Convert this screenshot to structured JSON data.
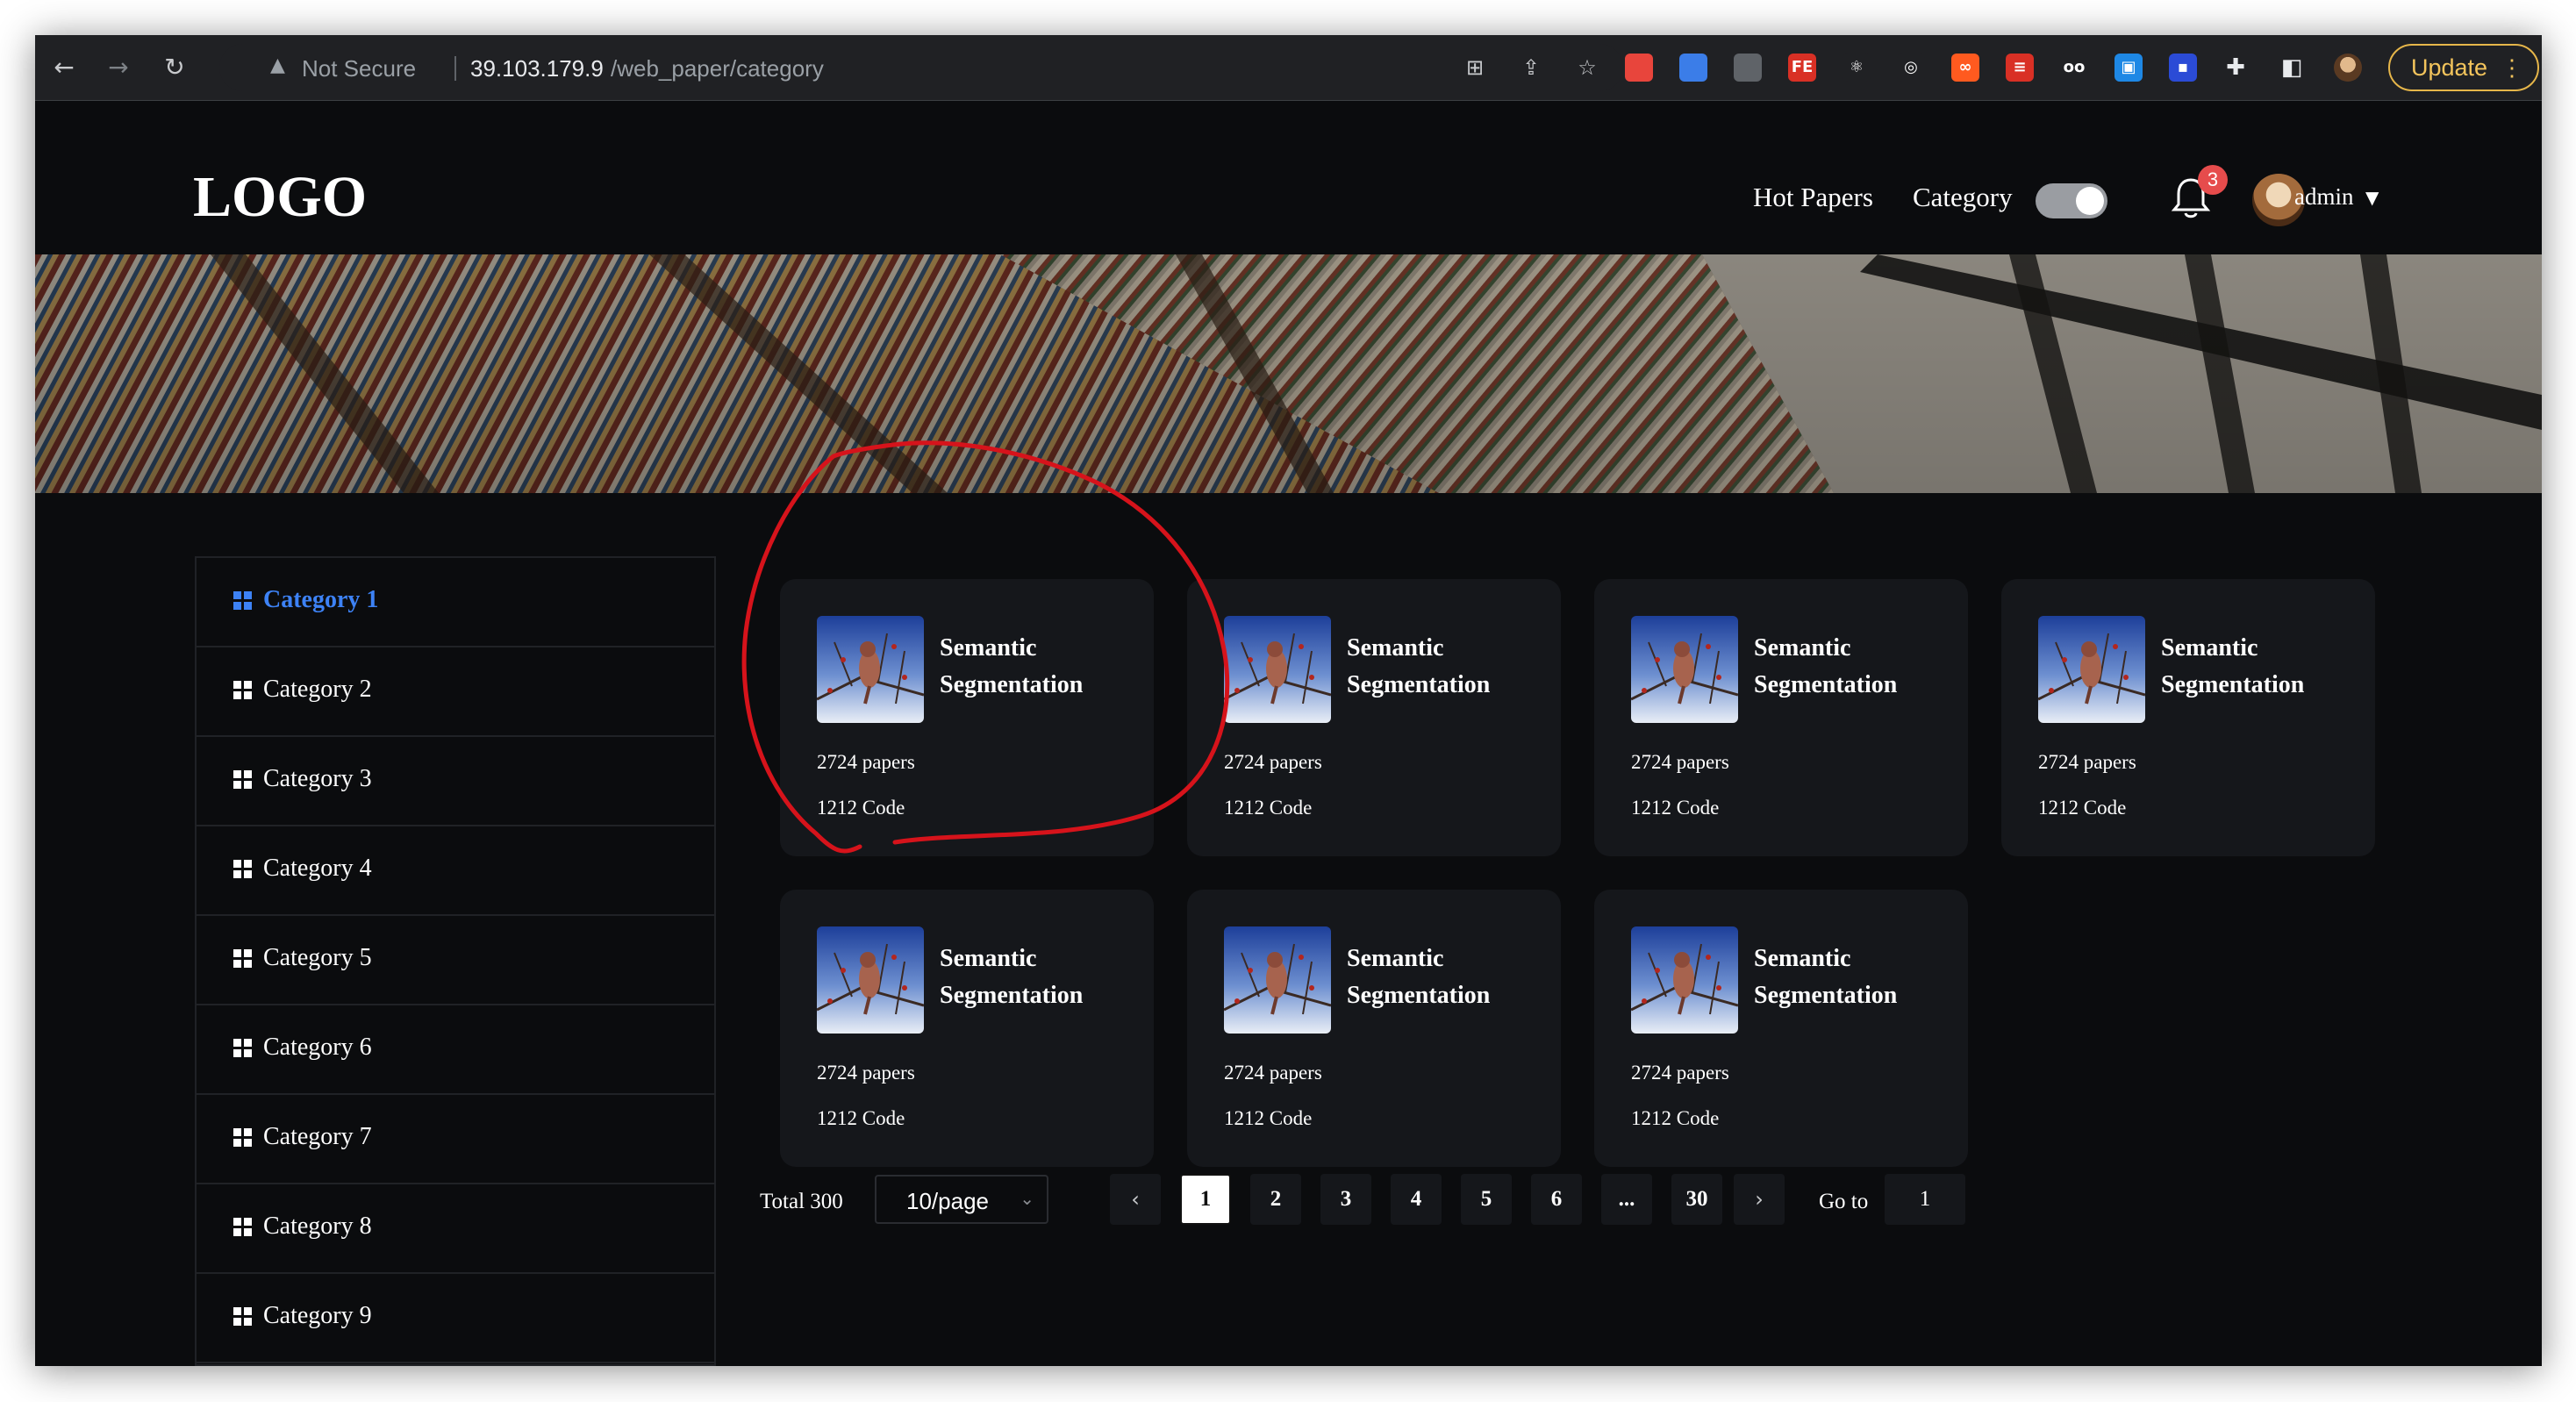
{
  "browser": {
    "security_label": "Not Secure",
    "url_host": "39.103.179.9",
    "url_path": "/web_paper/category",
    "update_label": "Update",
    "extensions": [
      {
        "name": "color-wheel-extension-icon",
        "glyph": "",
        "color": "#e8453c"
      },
      {
        "name": "cloud-extension-icon",
        "glyph": "",
        "color": "#3b7de8"
      },
      {
        "name": "gray-square-extension-icon",
        "glyph": "",
        "color": "#5f6368"
      },
      {
        "name": "fe-extension-icon",
        "glyph": "FE",
        "color": "#d93025"
      },
      {
        "name": "react-extension-icon",
        "glyph": "⚛",
        "color": "#202124"
      },
      {
        "name": "target-extension-icon",
        "glyph": "◎",
        "color": "#202124"
      },
      {
        "name": "infinity-extension-icon",
        "glyph": "∞",
        "color": "#ff5a1f"
      },
      {
        "name": "red-list-extension-icon",
        "glyph": "≡",
        "color": "#d93025"
      },
      {
        "name": "glasses-extension-icon",
        "glyph": "oo",
        "color": "#202124"
      },
      {
        "name": "robot-extension-icon",
        "glyph": "▣",
        "color": "#1e88e5"
      },
      {
        "name": "blue-box-extension-icon",
        "glyph": "▪",
        "color": "#2b4bd6"
      }
    ]
  },
  "header": {
    "logo": "LOGO",
    "nav": [
      "Hot Papers",
      "Category"
    ],
    "notification_count": "3",
    "username": "admin"
  },
  "sidebar": {
    "items": [
      {
        "label": "Category 1",
        "active": true
      },
      {
        "label": "Category 2",
        "active": false
      },
      {
        "label": "Category 3",
        "active": false
      },
      {
        "label": "Category 4",
        "active": false
      },
      {
        "label": "Category 5",
        "active": false
      },
      {
        "label": "Category 6",
        "active": false
      },
      {
        "label": "Category 7",
        "active": false
      },
      {
        "label": "Category 8",
        "active": false
      },
      {
        "label": "Category 9",
        "active": false
      }
    ]
  },
  "cards": [
    {
      "title": "Semantic Segmentation",
      "papers": "2724 papers",
      "code": "1212 Code"
    },
    {
      "title": "Semantic Segmentation",
      "papers": "2724 papers",
      "code": "1212 Code"
    },
    {
      "title": "Semantic Segmentation",
      "papers": "2724 papers",
      "code": "1212 Code"
    },
    {
      "title": "Semantic Segmentation",
      "papers": "2724 papers",
      "code": "1212 Code"
    },
    {
      "title": "Semantic Segmentation",
      "papers": "2724 papers",
      "code": "1212 Code"
    },
    {
      "title": "Semantic Segmentation",
      "papers": "2724 papers",
      "code": "1212 Code"
    },
    {
      "title": "Semantic Segmentation",
      "papers": "2724 papers",
      "code": "1212 Code"
    }
  ],
  "pagination": {
    "total_label": "Total 300",
    "page_size_label": "10/page",
    "pages": [
      "1",
      "2",
      "3",
      "4",
      "5",
      "6",
      "...",
      "30"
    ],
    "current_page": "1",
    "goto_label": "Go to",
    "goto_value": "1"
  },
  "colors": {
    "accent": "#3d82f5",
    "annotation_circle": "#d6131b"
  }
}
